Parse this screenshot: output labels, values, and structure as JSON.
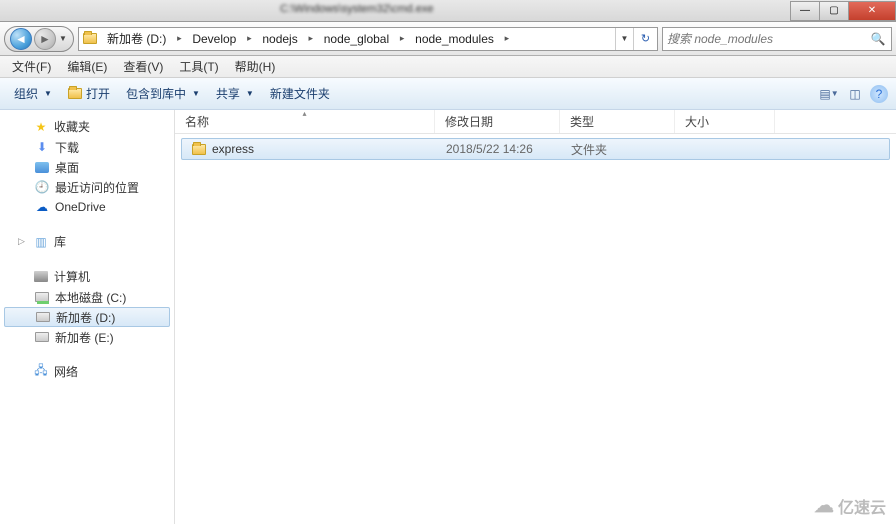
{
  "titlebar": {
    "title": "C:\\Windows\\system32\\cmd.exe"
  },
  "window_controls": {
    "min": "—",
    "max": "▢",
    "close": "✕"
  },
  "nav": {
    "back_glyph": "◄",
    "fwd_glyph": "►",
    "dd_glyph": "▼",
    "refresh_glyph": "↻"
  },
  "breadcrumb": {
    "segments": [
      {
        "label": "新加卷 (D:)"
      },
      {
        "label": "Develop"
      },
      {
        "label": "nodejs"
      },
      {
        "label": "node_global"
      },
      {
        "label": "node_modules"
      }
    ]
  },
  "search": {
    "placeholder": "搜索 node_modules"
  },
  "menu": {
    "file": "文件(F)",
    "edit": "编辑(E)",
    "view": "查看(V)",
    "tools": "工具(T)",
    "help": "帮助(H)"
  },
  "toolbar": {
    "organize": "组织",
    "open": "打开",
    "include": "包含到库中",
    "share": "共享",
    "newfolder": "新建文件夹"
  },
  "navpane": {
    "favorites": {
      "label": "收藏夹",
      "items": [
        {
          "label": "下载",
          "icon": "download"
        },
        {
          "label": "桌面",
          "icon": "desktop"
        },
        {
          "label": "最近访问的位置",
          "icon": "recent"
        },
        {
          "label": "OneDrive",
          "icon": "onedrive"
        }
      ]
    },
    "libraries": {
      "label": "库"
    },
    "computer": {
      "label": "计算机",
      "items": [
        {
          "label": "本地磁盘 (C:)",
          "icon": "drive-c"
        },
        {
          "label": "新加卷 (D:)",
          "icon": "drive",
          "selected": true
        },
        {
          "label": "新加卷 (E:)",
          "icon": "drive"
        }
      ]
    },
    "network": {
      "label": "网络"
    }
  },
  "columns": {
    "name": "名称",
    "date": "修改日期",
    "type": "类型",
    "size": "大小"
  },
  "files": [
    {
      "name": "express",
      "date": "2018/5/22 14:26",
      "type": "文件夹",
      "size": "",
      "selected": true
    }
  ],
  "watermark": {
    "text": "亿速云"
  }
}
